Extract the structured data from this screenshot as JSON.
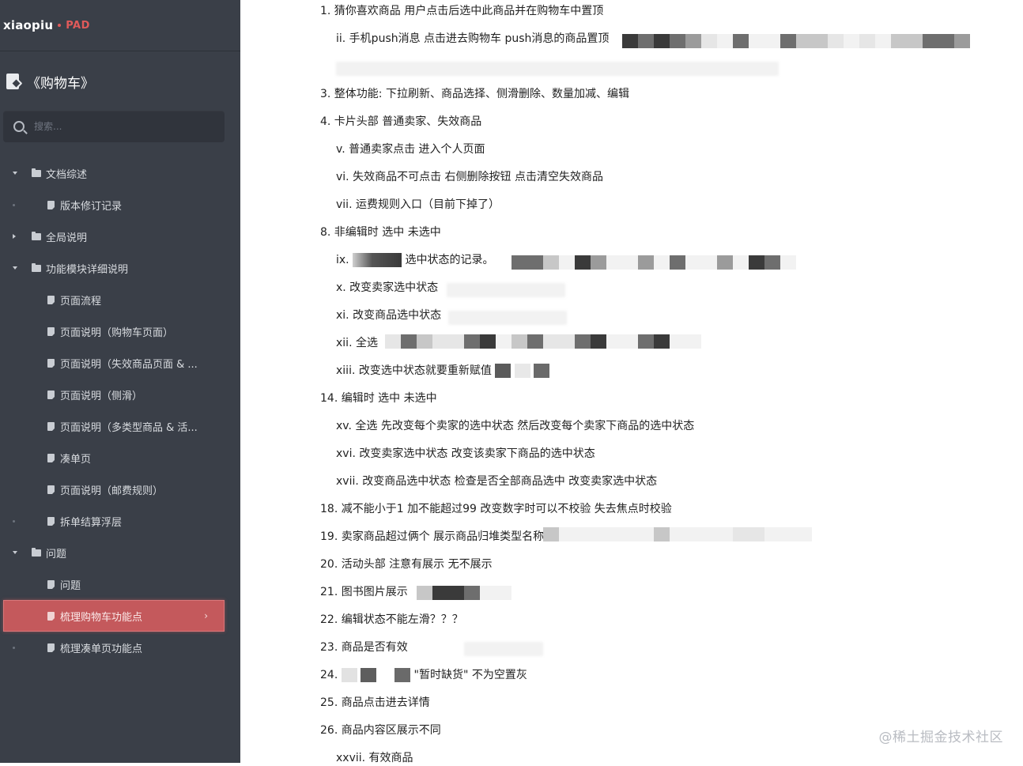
{
  "brand": {
    "name": "xiaopiu",
    "product": "PAD"
  },
  "sidebar": {
    "doc_title": "《购物车》",
    "search_placeholder": "搜索...",
    "items": [
      {
        "type": "folder",
        "label": "文档综述",
        "expanded": true
      },
      {
        "type": "page",
        "label": "版本修订记录"
      },
      {
        "type": "folder",
        "label": "全局说明",
        "expanded": false
      },
      {
        "type": "folder",
        "label": "功能模块详细说明",
        "expanded": true
      },
      {
        "type": "page",
        "label": "页面流程"
      },
      {
        "type": "page",
        "label": "页面说明（购物车页面）"
      },
      {
        "type": "page",
        "label": "页面说明（失效商品页面 & ..."
      },
      {
        "type": "page",
        "label": "页面说明（侧滑）"
      },
      {
        "type": "page",
        "label": "页面说明（多类型商品 & 活..."
      },
      {
        "type": "page",
        "label": "凑单页"
      },
      {
        "type": "page",
        "label": "页面说明（邮费规则）"
      },
      {
        "type": "page",
        "label": "拆单结算浮层"
      },
      {
        "type": "folder",
        "label": "问题",
        "expanded": true
      },
      {
        "type": "page",
        "label": "问题"
      },
      {
        "type": "page",
        "label": "梳理购物车功能点",
        "active": true
      },
      {
        "type": "page",
        "label": "梳理凑单页功能点"
      }
    ]
  },
  "content": {
    "lines": [
      "1. 猜你喜欢商品 用户点击后选中此商品并在购物车中置顶",
      "ii. 手机push消息 点击进去购物车 push消息的商品置顶",
      "3. 整体功能: 下拉刷新、商品选择、侧滑删除、数量加减、编辑",
      "4. 卡片头部 普通卖家、失效商品",
      "v.  普通卖家点击 进入个人页面",
      "vi. 失效商品不可点击 右侧删除按钮 点击清空失效商品",
      "vii. 运费规则入口（目前下掉了）",
      "8. 非编辑时 选中 未选中",
      "ix.",
      "选中状态的记录。",
      "x. 改变卖家选中状态",
      "xi. 改变商品选中状态",
      "xii. 全选",
      "xiii. 改变选中状态就要重新赋值",
      "14. 编辑时 选中 未选中",
      "xv. 全选 先改变每个卖家的选中状态 然后改变每个卖家下商品的选中状态",
      "xvi. 改变卖家选中状态 改变该卖家下商品的选中状态",
      "xvii. 改变商品选中状态 检查是否全部商品选中 改变卖家选中状态",
      "18. 减不能小于1 加不能超过99 改变数字时可以不校验 失去焦点时校验",
      "19. 卖家商品超过俩个 展示商品归堆类型名称",
      "20. 活动头部 注意有展示 无不展示",
      "21. 图书图片展示",
      "22. 编辑状态不能左滑？？？",
      "23. 商品是否有效",
      "24.",
      "\"暂时缺货\" 不为空置灰",
      "25. 商品点击进去详情",
      "26. 商品内容区展示不同",
      "xxvii.  有效商品"
    ]
  },
  "watermark": "@稀土掘金技术社区",
  "colors": {
    "sidebar_bg": "#3a3f48",
    "active_bg": "#c4595c",
    "brand_accent": "#e05a5a"
  }
}
